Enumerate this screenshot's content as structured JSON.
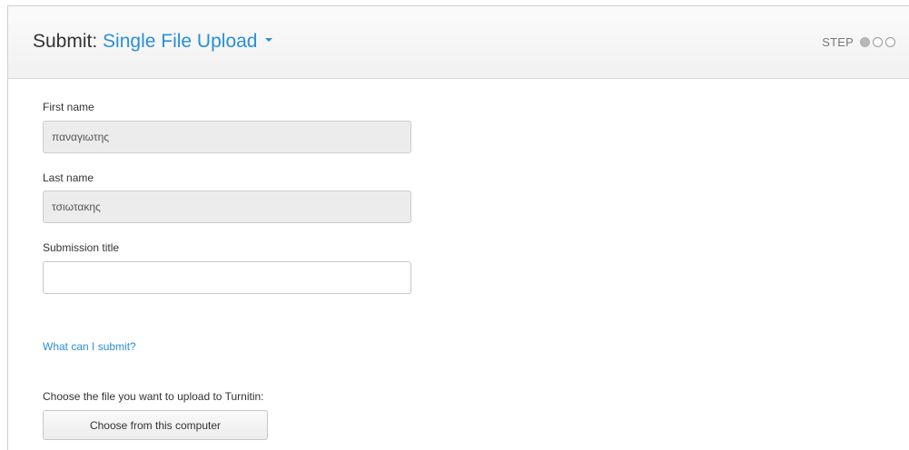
{
  "header": {
    "title_prefix": "Submit:",
    "title_link": "Single File Upload",
    "step_label": "STEP",
    "step_current": 1,
    "step_total": 3
  },
  "form": {
    "first_name": {
      "label": "First name",
      "value": "παναγιωτης"
    },
    "last_name": {
      "label": "Last name",
      "value": "τσιωτακης"
    },
    "submission_title": {
      "label": "Submission title",
      "value": ""
    },
    "what_can_i_submit": "What can I submit?",
    "choose_file_text": "Choose the file you want to upload to Turnitin:",
    "choose_button": "Choose from this computer"
  },
  "colors": {
    "accent": "#2a8fd6",
    "readonly_field": "#ececec"
  }
}
